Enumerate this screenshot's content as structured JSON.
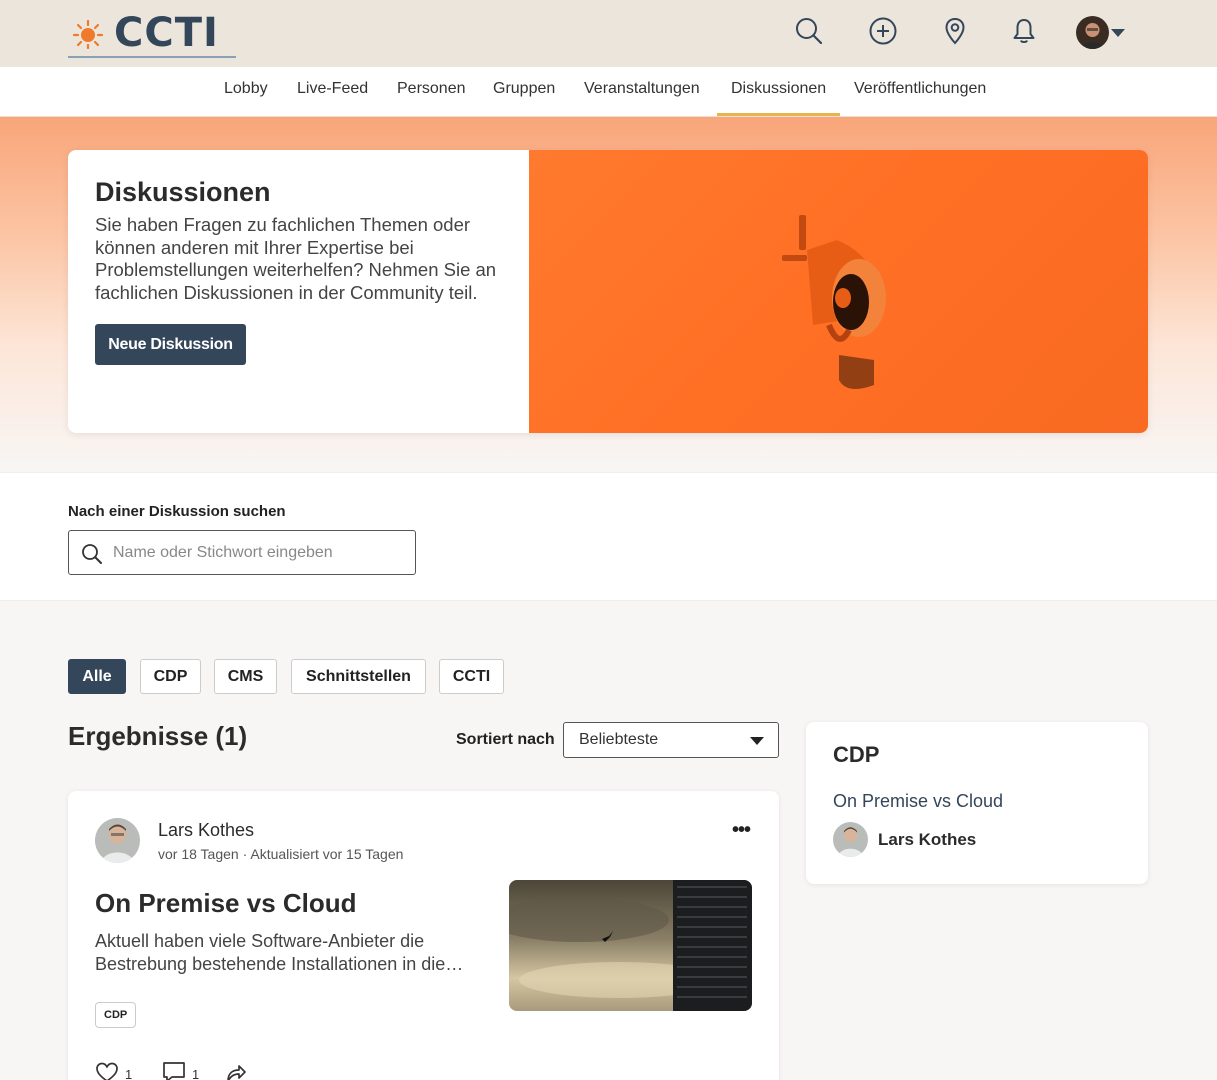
{
  "header": {
    "logo_text": "CCTI",
    "icons": [
      "search-icon",
      "plus-circle-icon",
      "map-pin-icon",
      "bell-icon"
    ],
    "accent_color": "#34465a",
    "logo_sun_color": "#f07a2c"
  },
  "nav": {
    "items": [
      {
        "label": "Lobby"
      },
      {
        "label": "Live-Feed"
      },
      {
        "label": "Personen"
      },
      {
        "label": "Gruppen"
      },
      {
        "label": "Veranstaltungen"
      },
      {
        "label": "Diskussionen",
        "active": true
      },
      {
        "label": "Veröffentlichungen"
      }
    ],
    "active_color": "#e8b44c"
  },
  "hero": {
    "title": "Diskussionen",
    "description": "Sie haben Fragen zu fachlichen Themen oder können anderen mit Ihrer Expertise bei Problemstellungen weiterhelfen? Nehmen Sie an fachlichen Diskussionen in der Community teil.",
    "button_label": "Neue Diskussion",
    "image_color": "#ff7a2e"
  },
  "search": {
    "label": "Nach einer Diskussion suchen",
    "placeholder": "Name oder Stichwort eingeben",
    "value": ""
  },
  "filters": {
    "chips": [
      {
        "label": "Alle",
        "active": true
      },
      {
        "label": "CDP"
      },
      {
        "label": "CMS"
      },
      {
        "label": "Schnittstellen"
      },
      {
        "label": "CCTI"
      }
    ]
  },
  "results": {
    "title": "Ergebnisse (1)",
    "sort_label": "Sortiert nach",
    "sort_value": "Beliebteste"
  },
  "post": {
    "author": "Lars Kothes",
    "meta": "vor 18 Tagen · Aktualisiert vor 15 Tagen",
    "title": "On Premise vs Cloud",
    "excerpt": "Aktuell haben viele Software-Anbieter die Bestrebung bestehende Installationen in die Cloud zu überführen.",
    "tag": "CDP",
    "likes": "1",
    "comments": "1",
    "more_label": "•••"
  },
  "sidebar": {
    "title": "CDP",
    "link": "On Premise vs Cloud",
    "author": "Lars Kothes"
  }
}
